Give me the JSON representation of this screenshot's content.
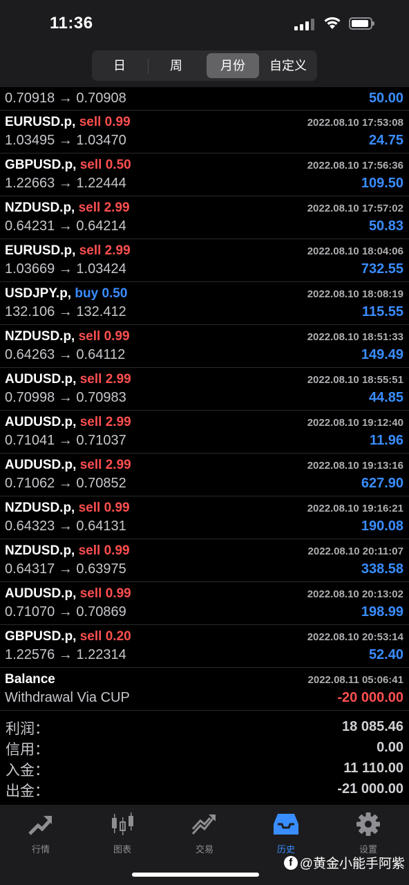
{
  "status_bar": {
    "time": "11:36"
  },
  "period_tabs": [
    {
      "label": "日",
      "active": false
    },
    {
      "label": "周",
      "active": false
    },
    {
      "label": "月份",
      "active": true
    },
    {
      "label": "自定义",
      "active": false
    }
  ],
  "first_row": {
    "prices": "0.70918 → 0.70908",
    "profit": "50.00"
  },
  "trades": [
    {
      "symbol": "EURUSD.p,",
      "side": "sell",
      "volume": "0.99",
      "time": "2022.08.10 17:53:08",
      "prices": "1.03495 → 1.03470",
      "profit": "24.75"
    },
    {
      "symbol": "GBPUSD.p,",
      "side": "sell",
      "volume": "0.50",
      "time": "2022.08.10 17:56:36",
      "prices": "1.22663 → 1.22444",
      "profit": "109.50"
    },
    {
      "symbol": "NZDUSD.p,",
      "side": "sell",
      "volume": "2.99",
      "time": "2022.08.10 17:57:02",
      "prices": "0.64231 → 0.64214",
      "profit": "50.83"
    },
    {
      "symbol": "EURUSD.p,",
      "side": "sell",
      "volume": "2.99",
      "time": "2022.08.10 18:04:06",
      "prices": "1.03669 → 1.03424",
      "profit": "732.55"
    },
    {
      "symbol": "USDJPY.p,",
      "side": "buy",
      "volume": "0.50",
      "time": "2022.08.10 18:08:19",
      "prices": "132.106 → 132.412",
      "profit": "115.55"
    },
    {
      "symbol": "NZDUSD.p,",
      "side": "sell",
      "volume": "0.99",
      "time": "2022.08.10 18:51:33",
      "prices": "0.64263 → 0.64112",
      "profit": "149.49"
    },
    {
      "symbol": "AUDUSD.p,",
      "side": "sell",
      "volume": "2.99",
      "time": "2022.08.10 18:55:51",
      "prices": "0.70998 → 0.70983",
      "profit": "44.85"
    },
    {
      "symbol": "AUDUSD.p,",
      "side": "sell",
      "volume": "2.99",
      "time": "2022.08.10 19:12:40",
      "prices": "0.71041 → 0.71037",
      "profit": "11.96"
    },
    {
      "symbol": "AUDUSD.p,",
      "side": "sell",
      "volume": "2.99",
      "time": "2022.08.10 19:13:16",
      "prices": "0.71062 → 0.70852",
      "profit": "627.90"
    },
    {
      "symbol": "NZDUSD.p,",
      "side": "sell",
      "volume": "0.99",
      "time": "2022.08.10 19:16:21",
      "prices": "0.64323 → 0.64131",
      "profit": "190.08"
    },
    {
      "symbol": "NZDUSD.p,",
      "side": "sell",
      "volume": "0.99",
      "time": "2022.08.10 20:11:07",
      "prices": "0.64317 → 0.63975",
      "profit": "338.58"
    },
    {
      "symbol": "AUDUSD.p,",
      "side": "sell",
      "volume": "0.99",
      "time": "2022.08.10 20:13:02",
      "prices": "0.71070 → 0.70869",
      "profit": "198.99"
    },
    {
      "symbol": "GBPUSD.p,",
      "side": "sell",
      "volume": "0.20",
      "time": "2022.08.10 20:53:14",
      "prices": "1.22576 → 1.22314",
      "profit": "52.40"
    }
  ],
  "balance_row": {
    "title": "Balance",
    "time": "2022.08.11 05:06:41",
    "comment": "Withdrawal Via CUP",
    "amount": "-20 000.00"
  },
  "summary": [
    {
      "label": "利润：",
      "value": "18 085.46"
    },
    {
      "label": "信用：",
      "value": "0.00"
    },
    {
      "label": "入金：",
      "value": "11 110.00"
    },
    {
      "label": "出金：",
      "value": "-21 000.00"
    }
  ],
  "tabbar": [
    {
      "label": "行情",
      "icon": "trending-arrow-icon",
      "active": false
    },
    {
      "label": "图表",
      "icon": "candlestick-icon",
      "active": false
    },
    {
      "label": "交易",
      "icon": "trade-chart-icon",
      "active": false
    },
    {
      "label": "历史",
      "icon": "inbox-tray-icon",
      "active": true
    },
    {
      "label": "设置",
      "icon": "gear-icon",
      "active": false
    }
  ],
  "watermark": "@黄金小能手阿紫",
  "colors": {
    "sell": "#ff4f4f",
    "buy": "#3a8dff",
    "profit": "#3a8dff",
    "background": "#000000"
  }
}
